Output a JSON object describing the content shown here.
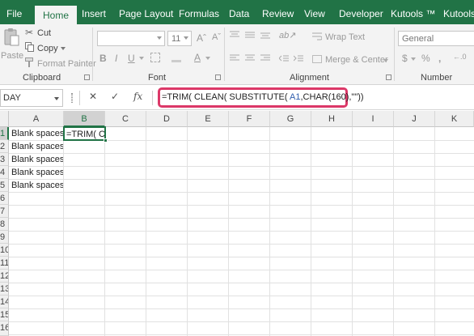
{
  "ribbon_tabs": [
    "File",
    "Home",
    "Insert",
    "Page Layout",
    "Formulas",
    "Data",
    "Review",
    "View",
    "Developer",
    "Kutools ™",
    "Kutools P"
  ],
  "active_tab": "Home",
  "clipboard": {
    "paste_label": "Paste",
    "cut_label": "Cut",
    "copy_label": "Copy",
    "format_painter_label": "Format Painter",
    "group_label": "Clipboard"
  },
  "font": {
    "size_value": "11",
    "bold": "B",
    "italic": "I",
    "underline": "U",
    "group_label": "Font"
  },
  "alignment": {
    "wrap_text_label": "Wrap Text",
    "merge_center_label": "Merge & Center",
    "group_label": "Alignment"
  },
  "number": {
    "format_value": "General",
    "currency_symbol": "$",
    "percent_symbol": "%",
    "group_label": "Number"
  },
  "formula_bar": {
    "name_box": "DAY",
    "fx": "fx",
    "formula_prefix": "=TRIM( CLEAN( SUBSTITUTE( ",
    "formula_ref": "A1",
    "formula_suffix": ",CHAR(160),\"\"))"
  },
  "columns": [
    "A",
    "B",
    "C",
    "D",
    "E",
    "F",
    "G",
    "H",
    "I",
    "J",
    "K"
  ],
  "rows": [
    "1",
    "2",
    "3",
    "4",
    "5",
    "6",
    "7",
    "8",
    "9",
    "10",
    "11",
    "12",
    "13",
    "14",
    "15",
    "16"
  ],
  "cells": {
    "A1": "Blank spaces",
    "A2": "Blank spaces",
    "A3": "Blank spaces",
    "A4": "Blank spaces",
    "A5": "Blank spaces",
    "B1": "=TRIM( CL"
  },
  "colors": {
    "accent": "#217346",
    "highlight": "#dc3868",
    "reference": "#2f5dad"
  }
}
